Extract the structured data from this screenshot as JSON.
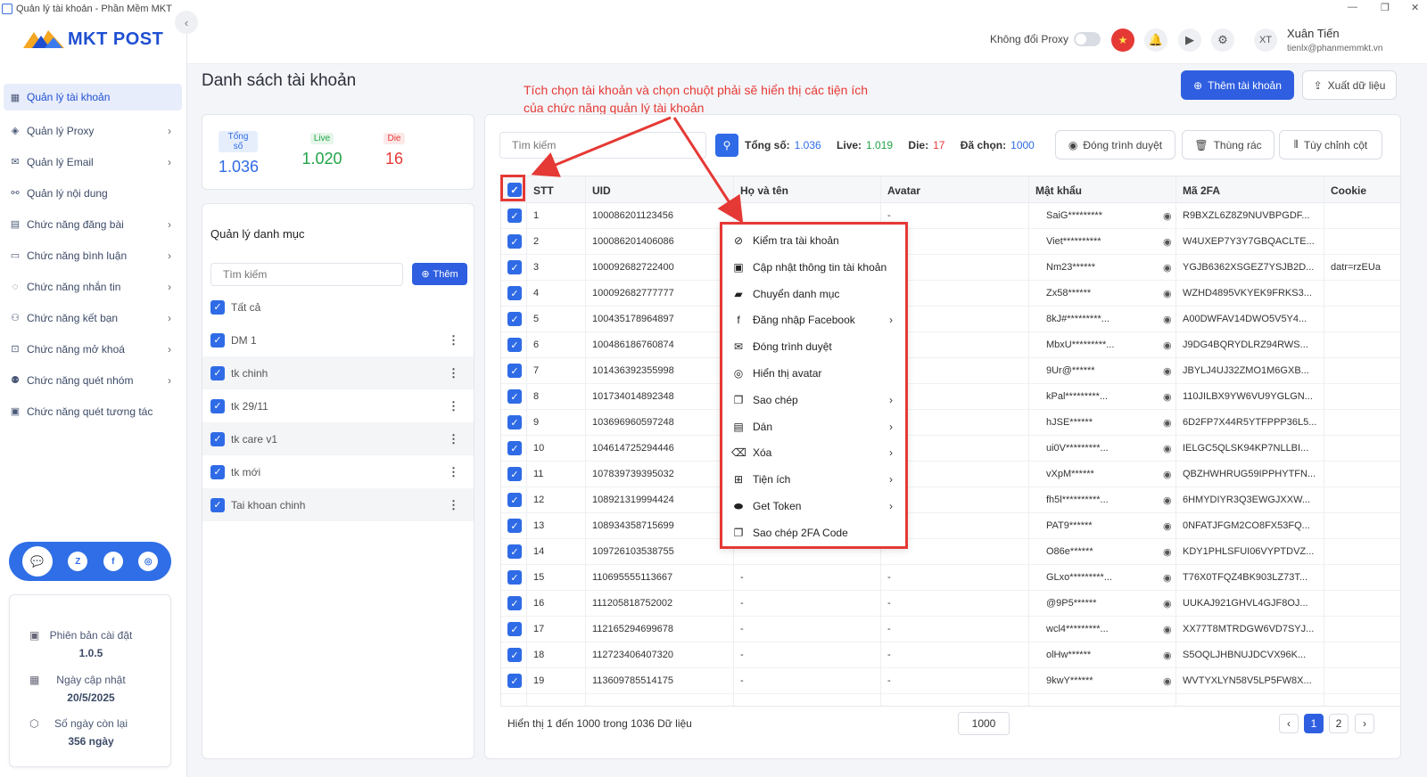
{
  "window": {
    "title": "Quản lý tài khoản - Phần Mềm MKT"
  },
  "brand": {
    "name": "MKT POST",
    "accent": "#2f5fe0",
    "red": "#e53935"
  },
  "sidebar": {
    "items": [
      {
        "label": "Quản lý tài khoản",
        "icon": "grid-icon",
        "arrow": false
      },
      {
        "label": "Quản lý Proxy",
        "icon": "layers-icon",
        "arrow": true
      },
      {
        "label": "Quản lý Email",
        "icon": "mail-icon",
        "arrow": true
      },
      {
        "label": "Quản lý nội dung",
        "icon": "link-icon",
        "arrow": false
      },
      {
        "label": "Chức năng đăng bài",
        "icon": "post-icon",
        "arrow": true
      },
      {
        "label": "Chức năng bình luận",
        "icon": "comment-icon",
        "arrow": true
      },
      {
        "label": "Chức năng nhắn tin",
        "icon": "chat-icon",
        "arrow": true
      },
      {
        "label": "Chức năng kết bạn",
        "icon": "user-add-icon",
        "arrow": true
      },
      {
        "label": "Chức năng mở khoá",
        "icon": "lock-icon",
        "arrow": true
      },
      {
        "label": "Chức năng quét nhóm",
        "icon": "group-icon",
        "arrow": true
      },
      {
        "label": "Chức năng quét tương tác",
        "icon": "scan-icon",
        "arrow": false
      }
    ],
    "version": {
      "label": "Phiên bản cài đặt",
      "value": "1.0.5"
    },
    "updated": {
      "label": "Ngày cập nhật",
      "value": "20/5/2025"
    },
    "remaining": {
      "label": "Số ngày còn lại",
      "value": "356 ngày"
    }
  },
  "header": {
    "proxy_label": "Không đổi Proxy",
    "avatar_initials": "XT",
    "user_name": "Xuân Tiến",
    "user_email": "tienlx@phanmemmkt.vn"
  },
  "page": {
    "title": "Danh sách tài khoản",
    "annotation_line1": "Tích chọn tài khoản và chọn chuột phải sẽ hiển thị các tiện ích",
    "annotation_line2": "của chức năng quản lý tài khoản",
    "add_account": "Thêm tài khoản",
    "export": "Xuất dữ liệu"
  },
  "stats": {
    "total_label": "Tổng số",
    "total": "1.036",
    "live_label": "Live",
    "live": "1.020",
    "die_label": "Die",
    "die": "16"
  },
  "categories": {
    "title": "Quản lý danh mục",
    "search_placeholder": "Tìm kiếm",
    "add_label": "Thêm",
    "items": [
      "Tất cả",
      "DM 1",
      "tk chinh",
      "tk 29/11",
      "tk care v1",
      "tk mới",
      "Tai khoan chinh"
    ]
  },
  "toolbar": {
    "search_placeholder": "Tìm kiếm",
    "total_label": "Tổng số:",
    "total": "1.036",
    "live_label": "Live:",
    "live": "1.019",
    "die_label": "Die:",
    "die": "17",
    "selected_label": "Đã chọn:",
    "selected": "1000",
    "close_browser": "Đóng trình duyệt",
    "trash": "Thùng rác",
    "columns": "Tùy chỉnh cột"
  },
  "table": {
    "headers": [
      "STT",
      "UID",
      "Họ và tên",
      "Avatar",
      "Mật khẩu",
      "Mã 2FA",
      "Cookie"
    ],
    "rows": [
      [
        "1",
        "100086201123456",
        "",
        "-",
        "SaiG*********",
        "R9BXZL6Z8Z9NUVBPGDF...",
        ""
      ],
      [
        "2",
        "100086201406086",
        "",
        "",
        "Viet**********",
        "W4UXEP7Y3Y7GBQACLTE...",
        ""
      ],
      [
        "3",
        "100092682722400",
        "",
        "",
        "Nm23******",
        "YGJB6362XSGEZ7YSJB2D...",
        "datr=rzEUa"
      ],
      [
        "4",
        "100092682777777",
        "",
        "",
        "Zx58******",
        "WZHD4895VKYEK9FRKS3...",
        ""
      ],
      [
        "5",
        "100435178964897",
        "",
        "",
        "8kJ#*********...",
        "A00DWFAV14DWO5V5Y4...",
        ""
      ],
      [
        "6",
        "100486186760874",
        "",
        "",
        "MbxU*********...",
        "J9DG4BQRYDLRZ94RWS...",
        ""
      ],
      [
        "7",
        "101436392355998",
        "",
        "",
        "9Ur@******",
        "JBYLJ4UJ32ZMO1M6GXB...",
        ""
      ],
      [
        "8",
        "101734014892348",
        "",
        "",
        "kPal*********...",
        "110JILBX9YW6VU9YGLGN...",
        ""
      ],
      [
        "9",
        "103696960597248",
        "",
        "",
        "hJSE******",
        "6D2FP7X44R5YTFPPP36L5...",
        ""
      ],
      [
        "10",
        "104614725294446",
        "",
        "",
        "ui0V*********...",
        "IELGC5QLSK94KP7NLLBI...",
        ""
      ],
      [
        "11",
        "107839739395032",
        "",
        "",
        "vXpM******",
        "QBZHWHRUG59IPPHYTFN...",
        ""
      ],
      [
        "12",
        "108921319994424",
        "",
        "",
        "fh5l**********...",
        "6HMYDIYR3Q3EWGJXXW...",
        ""
      ],
      [
        "13",
        "108934358715699",
        "",
        "",
        "PAT9******",
        "0NFATJFGM2CO8FX53FQ...",
        ""
      ],
      [
        "14",
        "109726103538755",
        "",
        "",
        "O86e******",
        "KDY1PHLSFUI06VYPTDVZ...",
        ""
      ],
      [
        "15",
        "110695555113667",
        "-",
        "-",
        "GLxo*********...",
        "T76X0TFQZ4BK903LZ73T...",
        ""
      ],
      [
        "16",
        "111205818752002",
        "-",
        "-",
        "@9P5******",
        "UUKAJ921GHVL4GJF8OJ...",
        ""
      ],
      [
        "17",
        "112165294699678",
        "-",
        "-",
        "wcl4*********...",
        "XX77T8MTRDGW6VD7SYJ...",
        ""
      ],
      [
        "18",
        "112723406407320",
        "-",
        "-",
        "olHw******",
        "S5OQLJHBNUJDCVX96K...",
        ""
      ],
      [
        "19",
        "113609785514175",
        "-",
        "-",
        "9kwY******",
        "WVTYXLYN58V5LP5FW8X...",
        ""
      ]
    ]
  },
  "pager": {
    "info": "Hiển thị 1 đến 1000 trong 1036 Dữ liệu",
    "page_size": "1000",
    "prev": "‹",
    "next": "›",
    "pages": [
      "1",
      "2"
    ]
  },
  "context_menu": {
    "items": [
      {
        "label": "Kiểm tra tài khoản",
        "icon": "check-circle-icon",
        "sub": false
      },
      {
        "label": "Cập nhật thông tin tài khoản",
        "icon": "file-plus-icon",
        "sub": false
      },
      {
        "label": "Chuyển danh mục",
        "icon": "folder-move-icon",
        "sub": false
      },
      {
        "label": "Đăng nhập Facebook",
        "icon": "facebook-icon",
        "sub": true
      },
      {
        "label": "Đóng trình duyệt",
        "icon": "mail-icon",
        "sub": false
      },
      {
        "label": "Hiển thị avatar",
        "icon": "user-circle-icon",
        "sub": false
      },
      {
        "label": "Sao chép",
        "icon": "copy-icon",
        "sub": true
      },
      {
        "label": "Dán",
        "icon": "paste-icon",
        "sub": true
      },
      {
        "label": "Xóa",
        "icon": "eraser-icon",
        "sub": true
      },
      {
        "label": "Tiện ích",
        "icon": "widgets-icon",
        "sub": true
      },
      {
        "label": "Get Token",
        "icon": "token-icon",
        "sub": true
      },
      {
        "label": "Sao chép 2FA Code",
        "icon": "copy-2fa-icon",
        "sub": false
      }
    ]
  }
}
